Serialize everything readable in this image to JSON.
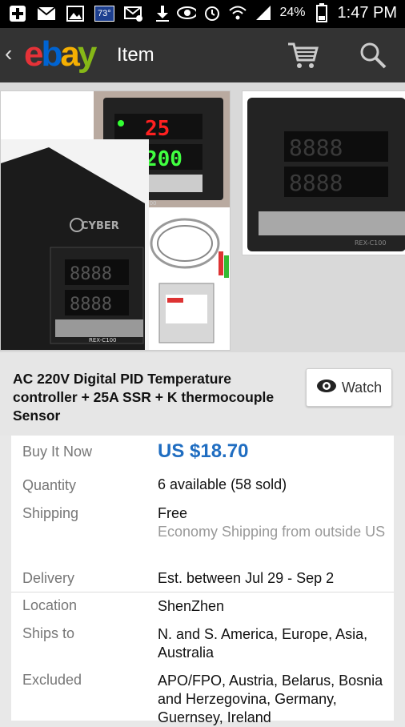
{
  "status_bar": {
    "temperature_badge": "73°",
    "battery": "24%",
    "time": "1:47 PM",
    "icons": [
      "add-icon",
      "mail-icon",
      "image-icon",
      "weather-icon",
      "email-icon",
      "download-icon",
      "eye-icon",
      "alarm-icon",
      "wifi-icon",
      "signal-icon",
      "battery-icon"
    ]
  },
  "app_bar": {
    "logo": {
      "e": "e",
      "b": "b",
      "a": "a",
      "y": "y"
    },
    "title": "Item"
  },
  "gallery": {
    "image1_brand": "CYBER",
    "image1_model": "REX-C100",
    "image1_display_pv": "25",
    "image1_display_sv": "200",
    "image2_model": "REX-C100"
  },
  "item": {
    "title": "AC 220V Digital PID Temperature controller + 25A SSR + K thermocouple Sensor",
    "watch_label": "Watch"
  },
  "details": {
    "buy_label": "Buy It Now",
    "price": "US $18.70",
    "quantity_label": "Quantity",
    "quantity": "6 available (58 sold)",
    "shipping_label": "Shipping",
    "shipping": "Free",
    "shipping_sub": "Economy Shipping from outside US",
    "delivery_label": "Delivery",
    "delivery": "Est. between Jul 29 - Sep 2",
    "location_label": "Location",
    "location": "ShenZhen",
    "ships_label": "Ships to",
    "ships": "N. and S. America, Europe, Asia, Australia",
    "excluded_label": "Excluded",
    "excluded": "APO/FPO, Austria, Belarus, Bosnia and Herzegovina, Germany, Guernsey, Ireland"
  },
  "colors": {
    "app_bar": "#333333",
    "price": "#1f6dc1",
    "ebay_red": "#e53238",
    "ebay_blue": "#0064d2",
    "ebay_yellow": "#f5af02",
    "ebay_green": "#86b817"
  }
}
